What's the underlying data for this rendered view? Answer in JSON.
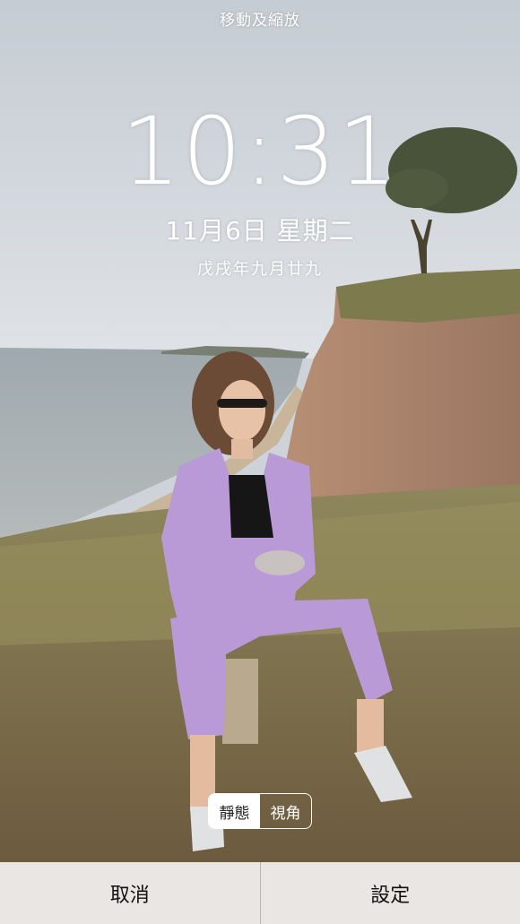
{
  "header": {
    "mode_label": "移動及縮放"
  },
  "lock_screen": {
    "time": "10:31",
    "date": "11月6日 星期二",
    "lunar_date": "戊戌年九月廿九"
  },
  "perspective_toggle": {
    "options": [
      "靜態",
      "視角"
    ],
    "selected": "靜態"
  },
  "actions": {
    "cancel_label": "取消",
    "set_label": "設定"
  },
  "colors": {
    "sky": "#d9dde2",
    "sea": "#9aa7ad",
    "cliff": "#a8816a",
    "grass": "#8f7d56",
    "suit": "#b99ad6",
    "bottom_bar": "#e9e6e3"
  }
}
